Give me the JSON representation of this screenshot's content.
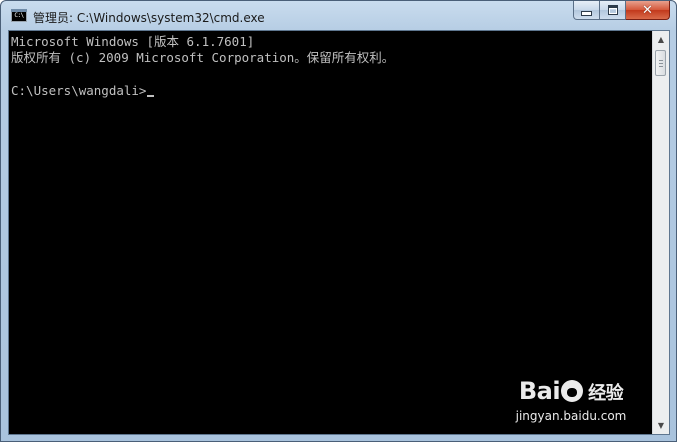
{
  "window": {
    "title": "管理员: C:\\Windows\\system32\\cmd.exe",
    "app_icon_text": "C:\\",
    "caption_buttons": {
      "minimize_icon": "minimize-icon",
      "maximize_icon": "maximize-icon",
      "close_icon": "close-icon",
      "close_glyph": "✕"
    }
  },
  "console": {
    "lines": [
      "Microsoft Windows [版本 6.1.7601]",
      "版权所有 (c) 2009 Microsoft Corporation。保留所有权利。",
      "",
      "C:\\Users\\wangdali>"
    ],
    "text_color": "#c0c0c0",
    "background": "#000000"
  },
  "scrollbar": {
    "up_glyph": "▲",
    "down_glyph": "▼"
  },
  "watermark": {
    "logo_left": "Bai",
    "logo_right": "经验",
    "url": "jingyan.baidu.com"
  }
}
